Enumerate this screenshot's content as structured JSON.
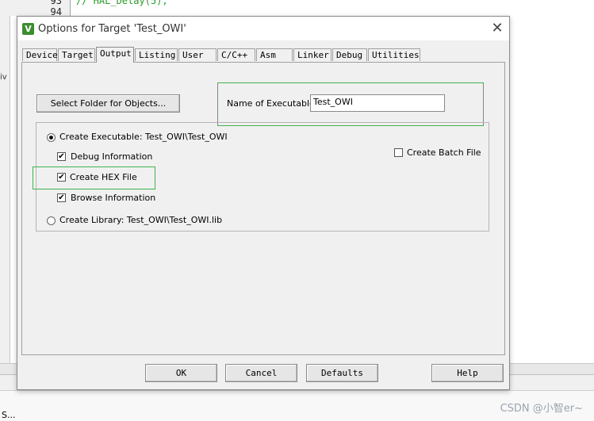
{
  "ide": {
    "line_numbers": [
      "93",
      "94"
    ],
    "code_line": "//  HAL_Delay(5);",
    "left_text": "iv",
    "status_text": "S..."
  },
  "watermark": "CSDN @小智er~",
  "dialog": {
    "title": "Options for Target 'Test_OWI'",
    "icon_letter": "V",
    "close_glyph": "✕",
    "tabs": [
      "Device",
      "Target",
      "Output",
      "Listing",
      "User",
      "C/C++",
      "Asm",
      "Linker",
      "Debug",
      "Utilities"
    ],
    "active_tab": "Output",
    "select_folder_label": "Select Folder for Objects...",
    "name_of_executable_label": "Name of Executable:",
    "name_of_executable_value": "Test_OWI",
    "create_executable_label": "Create Executable:  Test_OWI\\Test_OWI",
    "debug_info_label": "Debug Information",
    "create_hex_label": "Create HEX File",
    "browse_info_label": "Browse Information",
    "create_library_label": "Create Library:  Test_OWI\\Test_OWI.lib",
    "create_batch_label": "Create Batch File",
    "create_executable_checked": true,
    "debug_info_checked": true,
    "create_hex_checked": true,
    "browse_info_checked": true,
    "create_batch_checked": false,
    "check_glyph": "✔",
    "buttons": {
      "ok": "OK",
      "cancel": "Cancel",
      "defaults": "Defaults",
      "help": "Help"
    },
    "highlight_color": "#3fb34f"
  }
}
